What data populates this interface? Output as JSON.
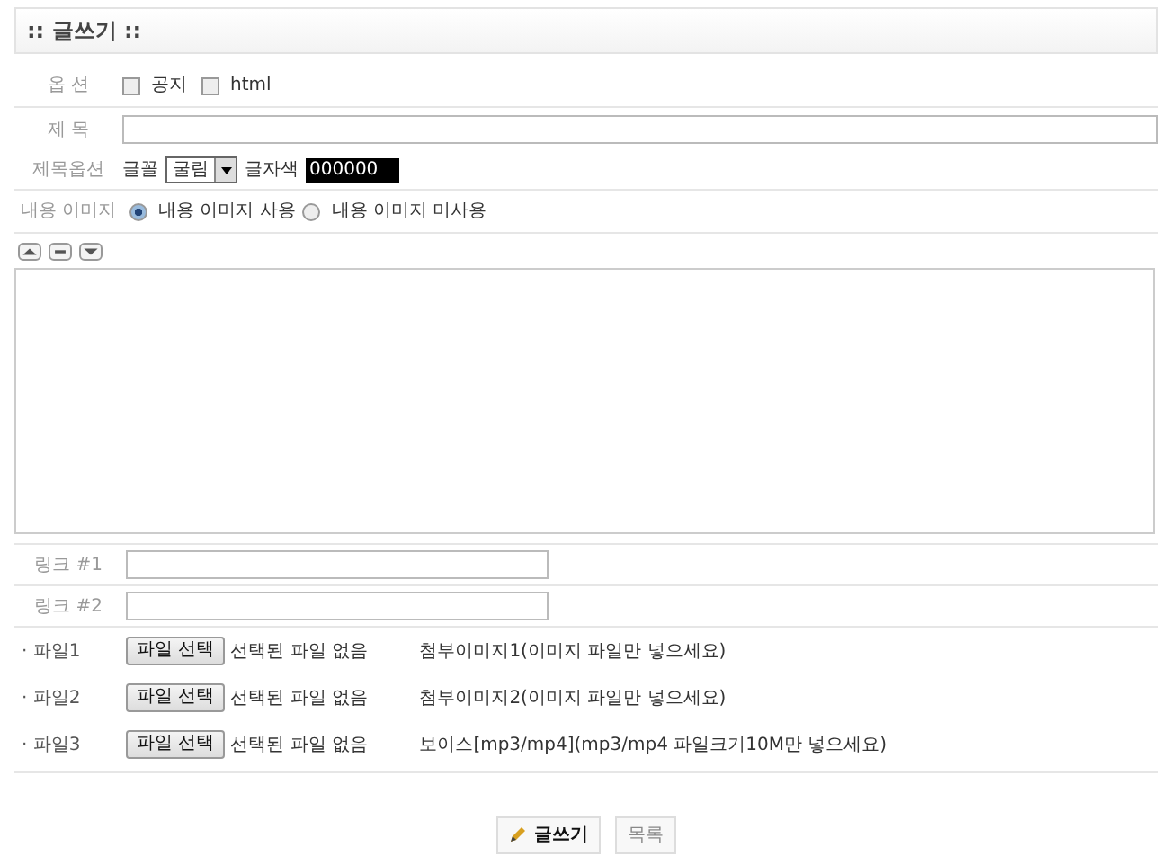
{
  "title": ":: 글쓰기 ::",
  "options": {
    "label": "옵 션",
    "checkboxes": [
      {
        "label": "공지",
        "checked": false
      },
      {
        "label": "html",
        "checked": false
      }
    ]
  },
  "subject": {
    "label": "제 목"
  },
  "subject_options": {
    "label": "제목옵션",
    "font_label": "글꼴",
    "font_value": "굴림",
    "color_label": "글자색",
    "color_value": "000000"
  },
  "content_image": {
    "label": "내용 이미지",
    "radios": [
      {
        "label": "내용 이미지 사용",
        "selected": true
      },
      {
        "label": "내용 이미지 미사용",
        "selected": false
      }
    ]
  },
  "links": [
    {
      "label": "링크 #1"
    },
    {
      "label": "링크 #2"
    }
  ],
  "files": [
    {
      "label": "· 파일1",
      "button": "파일 선택",
      "status": "선택된 파일 없음",
      "note": "첨부이미지1(이미지 파일만 넣으세요)"
    },
    {
      "label": "· 파일2",
      "button": "파일 선택",
      "status": "선택된 파일 없음",
      "note": "첨부이미지2(이미지 파일만 넣으세요)"
    },
    {
      "label": "· 파일3",
      "button": "파일 선택",
      "status": "선택된 파일 없음",
      "note": "보이스[mp3/mp4](mp3/mp4 파일크기10M만 넣으세요)"
    }
  ],
  "buttons": [
    {
      "label": "글쓰기",
      "kind": "write"
    },
    {
      "label": "목록",
      "kind": "list"
    }
  ]
}
